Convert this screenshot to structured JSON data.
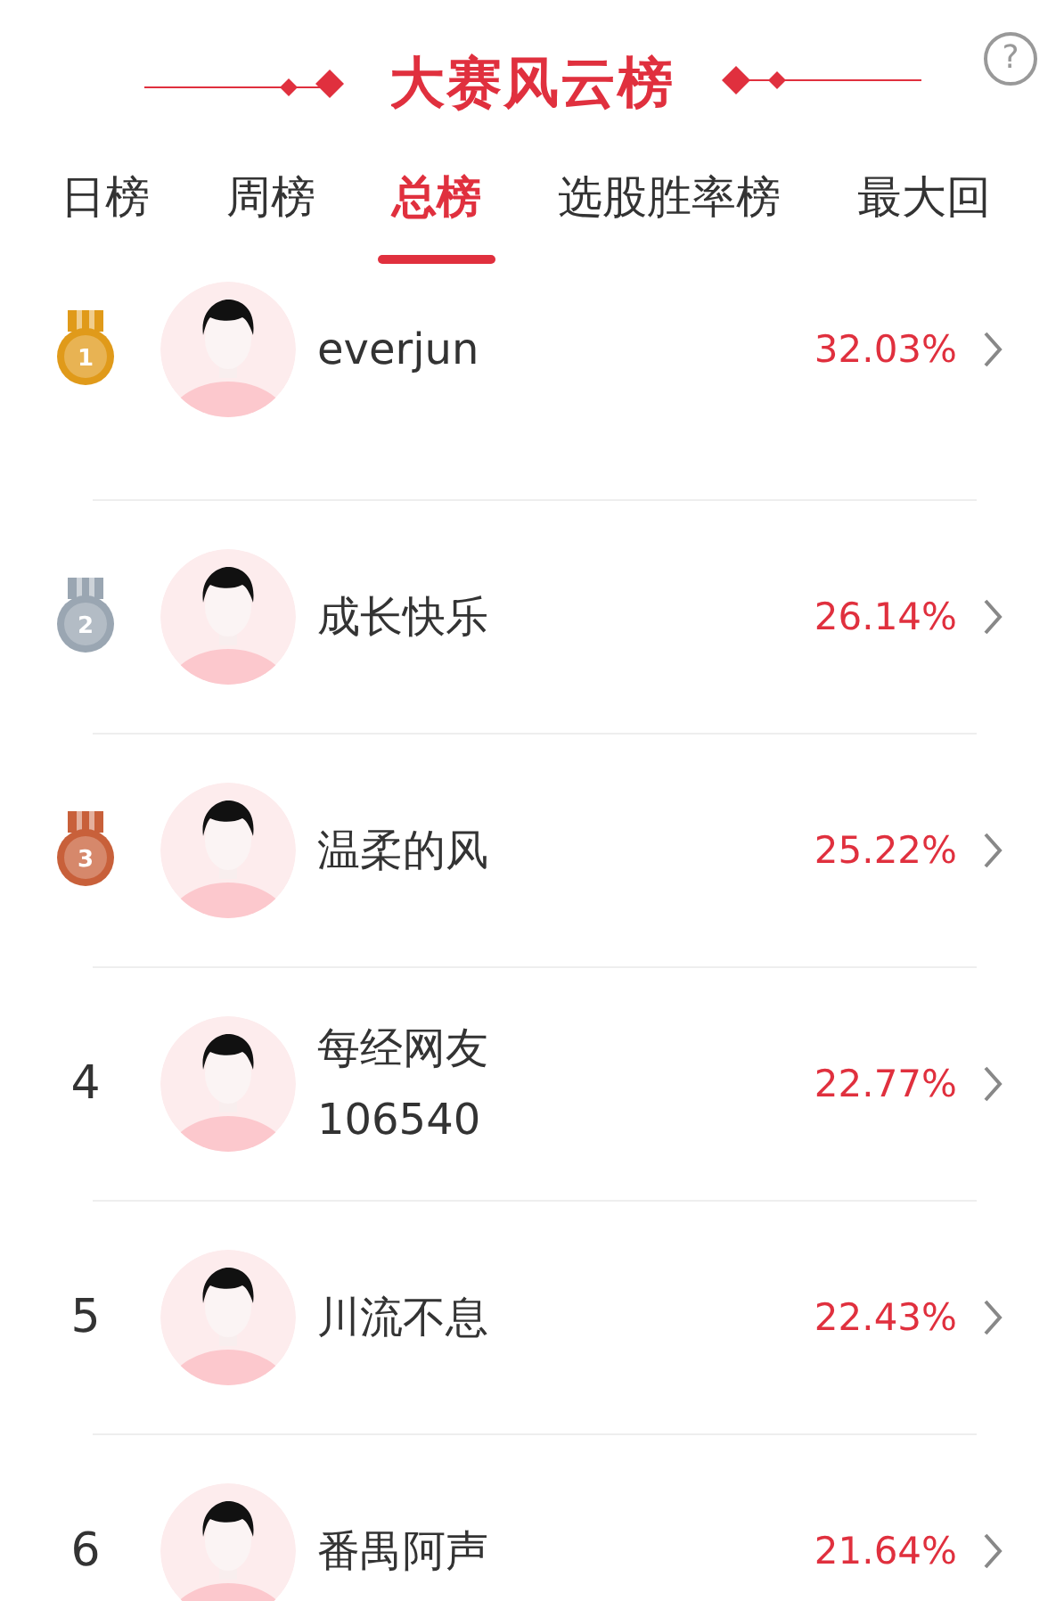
{
  "header": {
    "title": "大赛风云榜",
    "help": "?"
  },
  "tabs": [
    {
      "label": "日榜",
      "selected": false
    },
    {
      "label": "周榜",
      "selected": false
    },
    {
      "label": "总榜",
      "selected": true
    },
    {
      "label": "选股胜率榜",
      "selected": false
    },
    {
      "label": "最大回",
      "selected": false
    }
  ],
  "rows": [
    {
      "kind": "medal",
      "rank": "1",
      "color": "#e09a1a",
      "name": "everjun",
      "return": "32.03%"
    },
    {
      "kind": "medal",
      "rank": "2",
      "color": "#9aa6b2",
      "name": "成长快乐",
      "return": "26.14%"
    },
    {
      "kind": "medal",
      "rank": "3",
      "color": "#c8603a",
      "name": "温柔的风",
      "return": "25.22%"
    },
    {
      "kind": "number",
      "rank": "4",
      "name": "每经网友106540",
      "return": "22.77%"
    },
    {
      "kind": "number",
      "rank": "5",
      "name": "川流不息",
      "return": "22.43%"
    },
    {
      "kind": "number",
      "rank": "6",
      "name": "番禺阿声",
      "return": "21.64%"
    }
  ]
}
